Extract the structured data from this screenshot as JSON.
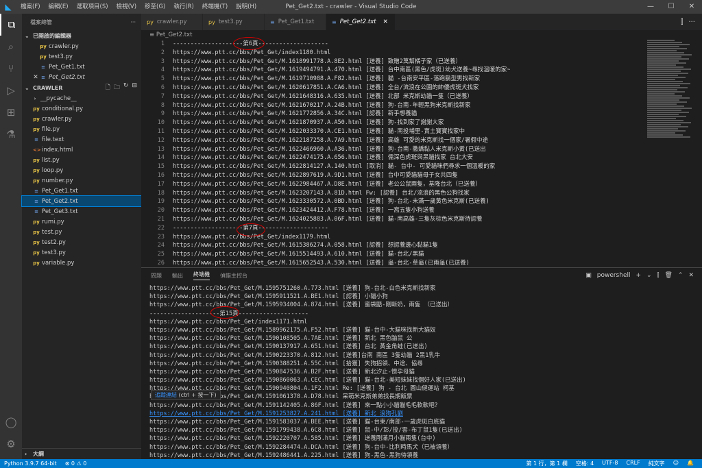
{
  "window": {
    "title": "Pet_Get2.txt - crawler - Visual Studio Code",
    "controls": [
      "—",
      "☐",
      "✕"
    ]
  },
  "menu": [
    "檔案(F)",
    "編輯(E)",
    "選取項目(S)",
    "檢視(V)",
    "移至(G)",
    "執行(R)",
    "終端機(T)",
    "說明(H)"
  ],
  "activity": [
    "files-icon",
    "search-icon",
    "source-control-icon",
    "run-debug-icon",
    "extensions-icon",
    "testing-icon"
  ],
  "activity_bottom": [
    "account-icon",
    "settings-gear-icon"
  ],
  "sidebar": {
    "header": "檔案總管",
    "header_more": "···",
    "open_editors_label": "已開啟的編輯器",
    "open_editors": [
      {
        "name": "crawler.py",
        "icon": "py",
        "color": "#e8c547",
        "italic": false
      },
      {
        "name": "test3.py",
        "icon": "py",
        "color": "#e8c547",
        "italic": false
      },
      {
        "name": "Pet_Get1.txt",
        "icon": "≡",
        "color": "#6997d5",
        "italic": false
      },
      {
        "name": "Pet_Get2.txt",
        "icon": "≡",
        "color": "#6997d5",
        "italic": true,
        "close": "✕"
      }
    ],
    "folder_label": "CRAWLER",
    "folder_tools": [
      "🗋",
      "🗀",
      "↻",
      "⊟"
    ],
    "files": [
      {
        "name": "__pycache__",
        "icon": "›",
        "color": "#ccc",
        "indent": 8
      },
      {
        "name": "conditional.py",
        "icon": "py",
        "color": "#e8c547",
        "indent": 10
      },
      {
        "name": "crawler.py",
        "icon": "py",
        "color": "#e8c547",
        "indent": 10
      },
      {
        "name": "file.py",
        "icon": "py",
        "color": "#e8c547",
        "indent": 10
      },
      {
        "name": "file.text",
        "icon": "≡",
        "color": "#6997d5",
        "indent": 10
      },
      {
        "name": "index.html",
        "icon": "<>",
        "color": "#e37933",
        "indent": 10
      },
      {
        "name": "list.py",
        "icon": "py",
        "color": "#e8c547",
        "indent": 10
      },
      {
        "name": "loop.py",
        "icon": "py",
        "color": "#e8c547",
        "indent": 10
      },
      {
        "name": "number.py",
        "icon": "py",
        "color": "#e8c547",
        "indent": 10
      },
      {
        "name": "Pet_Get1.txt",
        "icon": "≡",
        "color": "#6997d5",
        "indent": 10
      },
      {
        "name": "Pet_Get2.txt",
        "icon": "≡",
        "color": "#6997d5",
        "indent": 10,
        "selected": true
      },
      {
        "name": "Pet_Get3.txt",
        "icon": "≡",
        "color": "#6997d5",
        "indent": 10
      },
      {
        "name": "rumi.py",
        "icon": "py",
        "color": "#e8c547",
        "indent": 10
      },
      {
        "name": "test.py",
        "icon": "py",
        "color": "#e8c547",
        "indent": 10
      },
      {
        "name": "test2.py",
        "icon": "py",
        "color": "#e8c547",
        "indent": 10
      },
      {
        "name": "test3.py",
        "icon": "py",
        "color": "#e8c547",
        "indent": 10
      },
      {
        "name": "variable.py",
        "icon": "py",
        "color": "#e8c547",
        "indent": 10
      }
    ],
    "outline_label": "大綱"
  },
  "tabs": [
    {
      "name": "crawler.py",
      "icon": "py",
      "color": "#e8c547"
    },
    {
      "name": "test3.py",
      "icon": "py",
      "color": "#e8c547"
    },
    {
      "name": "Pet_Get1.txt",
      "icon": "≡",
      "color": "#6997d5"
    },
    {
      "name": "Pet_Get2.txt",
      "icon": "≡",
      "color": "#6997d5",
      "active": true,
      "close": "✕"
    }
  ],
  "tab_tools": [
    "⫿",
    "···"
  ],
  "breadcrumb": "≡ Pet_Get2.txt",
  "code": [
    {
      "n": "1",
      "t": "--------------------第6頁--------------------"
    },
    {
      "n": "2",
      "t": "https://www.ptt.cc/bbs/Pet_Get/index1180.html"
    },
    {
      "n": "3",
      "t": "https://www.ptt.cc/bbs/Pet_Get/M.1618991778.A.8E2.html [送養] 致贈2萬幫橘子家（已送養）"
    },
    {
      "n": "4",
      "t": "https://www.ptt.cc/bbs/Pet_Get/M.1619494791.A.470.html [送養] 台中南區(黑色/虎斑)幼犬送養~尋找溫暖的家~"
    },
    {
      "n": "5",
      "t": "https://www.ptt.cc/bbs/Pet_Get/M.1619710988.A.F82.html [送養] 貓 -台南安平區-落跑鬍型男找新家"
    },
    {
      "n": "6",
      "t": "https://www.ptt.cc/bbs/Pet_Get/M.1620617851.A.CA6.html [送養] 全台/流浪在公園的帥優虎斑犬找家"
    },
    {
      "n": "7",
      "t": "https://www.ptt.cc/bbs/Pet_Get/M.1621648316.A.635.html [送養] 北部 米克斯幼貓一隻（已送養）"
    },
    {
      "n": "8",
      "t": "https://www.ptt.cc/bbs/Pet_Get/M.1621670217.A.24B.html [送養] 狗-台南-年輕黑狗米克斯找新家"
    },
    {
      "n": "9",
      "t": "https://www.ptt.cc/bbs/Pet_Get/M.1621772856.A.34C.html [認養] 新手想養貓"
    },
    {
      "n": "10",
      "t": "https://www.ptt.cc/bbs/Pet_Get/M.1621870937.A.A50.html [送養] 狗-找到家了謝謝大家"
    },
    {
      "n": "11",
      "t": "https://www.ptt.cc/bbs/Pet_Get/M.1622033370.A.CE1.html [送養] 貓-南投埔里-賣土寶寶找家中"
    },
    {
      "n": "12",
      "t": "https://www.ptt.cc/bbs/Pet_Get/M.1622187258.A.7A9.html [送養] 高雄 可愛的米克斯找一個家/暑假中途"
    },
    {
      "n": "13",
      "t": "https://www.ptt.cc/bbs/Pet_Get/M.1622466960.A.A36.html [送養] 狗-台南-撒嬌黏人米克斯小黃(已送出"
    },
    {
      "n": "14",
      "t": "https://www.ptt.cc/bbs/Pet_Get/M.1622474175.A.656.html [送養] 儒深色虎斑與黑貓找家 台北大安"
    },
    {
      "n": "15",
      "t": "https://www.ptt.cc/bbs/Pet_Get/M.1622814127.A.140.html [取消] 貓- 台中- 可愛貓咪們尋求一個溫暖的家"
    },
    {
      "n": "16",
      "t": "https://www.ptt.cc/bbs/Pet_Get/M.1622897619.A.9D1.html [送養] 台中可愛貓貓母子女共四隻"
    },
    {
      "n": "17",
      "t": "https://www.ptt.cc/bbs/Pet_Get/M.1622984467.A.D8E.html [送養] 老公公鼠兩隻，基隆台北（已送養）"
    },
    {
      "n": "18",
      "t": "https://www.ptt.cc/bbs/Pet_Get/M.1623207143.A.81D.html Fw: [認養] 台北/流浪的黑色公狗找家"
    },
    {
      "n": "19",
      "t": "https://www.ptt.cc/bbs/Pet_Get/M.1623330572.A.0BD.html [送養] 狗-台北-未滿一歲黃色米克斯(已送養)"
    },
    {
      "n": "20",
      "t": "https://www.ptt.cc/bbs/Pet_Get/M.1623424412.A.F78.html [送養] 一窩五隻小狗送養"
    },
    {
      "n": "21",
      "t": "https://www.ptt.cc/bbs/Pet_Get/M.1624025883.A.06F.html [送養] 貓-南高雄-三隻灰棕色米克斯待認養"
    },
    {
      "n": "22",
      "t": "--------------------第7頁--------------------"
    },
    {
      "n": "23",
      "t": "https://www.ptt.cc/bbs/Pet_Get/index1179.html"
    },
    {
      "n": "24",
      "t": "https://www.ptt.cc/bbs/Pet_Get/M.1615386274.A.058.html [認養] 想認養邊心黏貓1隻"
    },
    {
      "n": "25",
      "t": "https://www.ptt.cc/bbs/Pet_Get/M.1615514493.A.610.html [送養] 貓-台北/黑貓"
    },
    {
      "n": "26",
      "t": "https://www.ptt.cc/bbs/Pet_Get/M.1615652543.A.530.html [送養] 龜-台北-草龜(已兩龜(已送養)"
    }
  ],
  "panel": {
    "tabs": [
      "問題",
      "輸出",
      "終端機",
      "偵錯主控台"
    ],
    "active_tab": "終端機",
    "shell": "powershell",
    "tools": [
      "+",
      "⌄",
      "⫿",
      "🗑",
      "⌃",
      "✕"
    ]
  },
  "terminal": [
    {
      "t": "https://www.ptt.cc/bbs/Pet_Get/M.1595751260.A.773.html [送養] 狗-台北-白色米克斯找新家"
    },
    {
      "t": "https://www.ptt.cc/bbs/Pet_Get/M.1595911521.A.BE1.html [認養] 小貓小狗"
    },
    {
      "t": "https://www.ptt.cc/bbs/Pet_Get/M.1595934004.A.874.html [送養] 蜜袋鼯-剛斷奶，兩隻 （已送出）"
    },
    {
      "t": "--------------------第15頁--------------------"
    },
    {
      "t": "https://www.ptt.cc/bbs/Pet_Get/index1171.html"
    },
    {
      "t": "https://www.ptt.cc/bbs/Pet_Get/M.1589962175.A.F52.html [送養] 貓-台中-大貓咪找新大貓奴"
    },
    {
      "t": "https://www.ptt.cc/bbs/Pet_Get/M.1590108505.A.7AE.html [送養] 新北 黑色鼬鼠 公"
    },
    {
      "t": "https://www.ptt.cc/bbs/Pet_Get/M.1590137917.A.651.html [送養] 台北 黃金角蛙(已送出)"
    },
    {
      "t": "https://www.ptt.cc/bbs/Pet_Get/M.1590223370.A.812.html [送養]台南 南區 3隻幼貓 2黑1乳牛"
    },
    {
      "t": "https://www.ptt.cc/bbs/Pet_Get/M.1590388251.A.55C.html [拾獲] 失狗招領、中途、協尋"
    },
    {
      "t": "https://www.ptt.cc/bbs/Pet_Get/M.1590847536.A.B2F.html [送養] 新北汐止-懷孕母貓"
    },
    {
      "t": "https://www.ptt.cc/bbs/Pet_Get/M.1590860063.A.CEC.html [送養] 貓-台北-美短妹妹找個好人家(已送出)"
    },
    {
      "t": "https://www.ptt.cc/bbs/Pet_Get/M.1590940804.A.1F2.html Re: [送養] 狗 - 台北 圓山健運站 柯基"
    },
    {
      "t": "https://www.ptt.cc/bbs/Pet_Get/M.1591061378.A.D78.html 呆萌米克斯弟弟找長期飯票"
    },
    {
      "t": "https://www.ptt.cc/bbs/Pet_Get/M.1591142405.A.86F.html [送養] 來一點小小貓貓毛毛軟軟吧？"
    },
    {
      "t": "https://www.ptt.cc/bbs/Pet_Get/M.1591253827.A.241.html [送養] 新北 浪狗孔劉",
      "link": true
    },
    {
      "t": "https://www.ptt.cc/bbs/Pet_Get/M.1591583037.A.BEE.html [送養] 貓-台東/南部-一歲虎斑白底貓"
    },
    {
      "t": "https://www.ptt.cc/bbs/Pet_Get/M.1591799438.A.6C8.html [送養] 鼠-中/彰/投/雲-布丁鼠1隻(已送出)"
    },
    {
      "t": "https://www.ptt.cc/bbs/Pet_Get/M.1592220707.A.585.html [送養] 送養剛滿月小貓兩隻(台中)"
    },
    {
      "t": "https://www.ptt.cc/bbs/Pet_Get/M.1592284474.A.DCA.html [送養] 狗-台中-比利時馬犬（已被領養）"
    },
    {
      "t": "https://www.ptt.cc/bbs/Pet_Get/M.1592486441.A.225.html [送養] 狗-黑色-黑狗待領養"
    },
    {
      "t": "https://www.ptt.cc/bbs/Pet_Get/M.1592745405.A.85C.html [送養] 貓-台中-棕色斑點幼貓2隻（均已被認養）"
    }
  ],
  "tooltip": {
    "action": "追蹤連結",
    "shortcut": " (ctrl + 按一下)"
  },
  "status": {
    "python": "Python 3.9.7 64-bit",
    "problems": "⊗ 0  ⚠ 0",
    "right": [
      "第 1 行，第 1 欄",
      "空格: 4",
      "UTF-8",
      "CRLF",
      "純文字",
      "☺",
      "🔔"
    ]
  },
  "colors": {
    "accent": "#007acc",
    "annotation": "#dd0000"
  }
}
